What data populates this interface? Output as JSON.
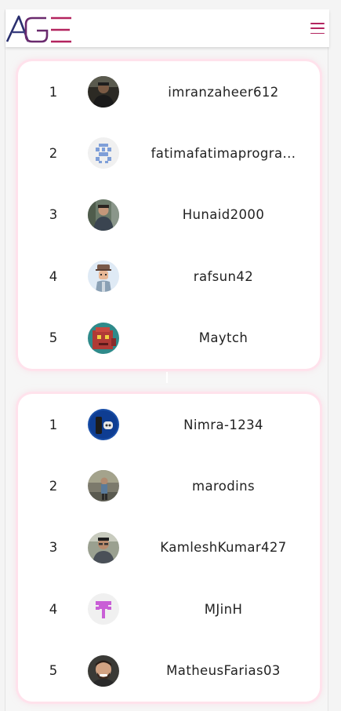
{
  "brand": {
    "logo_text": "AGE",
    "colors": {
      "left": "#2a2f6e",
      "right": "#b3245f",
      "accent": "#b3245f"
    }
  },
  "navbar": {
    "menu_icon": "hamburger-menu-icon"
  },
  "leaderboards": [
    {
      "entries": [
        {
          "rank": "1",
          "username": "imranzaheer612",
          "avatar": "photo-dark"
        },
        {
          "rank": "2",
          "username": "fatimafatimaprogra...",
          "avatar": "identicon-blue"
        },
        {
          "rank": "3",
          "username": "Hunaid2000",
          "avatar": "photo-outdoor"
        },
        {
          "rank": "4",
          "username": "rafsun42",
          "avatar": "cartoon-man"
        },
        {
          "rank": "5",
          "username": "Maytch",
          "avatar": "pixel-red"
        }
      ]
    },
    {
      "entries": [
        {
          "rank": "1",
          "username": "Nimra-1234",
          "avatar": "console-blue"
        },
        {
          "rank": "2",
          "username": "marodins",
          "avatar": "photo-outdoor"
        },
        {
          "rank": "3",
          "username": "KamleshKumar427",
          "avatar": "photo-man"
        },
        {
          "rank": "4",
          "username": "MJinH",
          "avatar": "identicon-purple"
        },
        {
          "rank": "5",
          "username": "MatheusFarias03",
          "avatar": "photo-smile"
        }
      ]
    }
  ]
}
